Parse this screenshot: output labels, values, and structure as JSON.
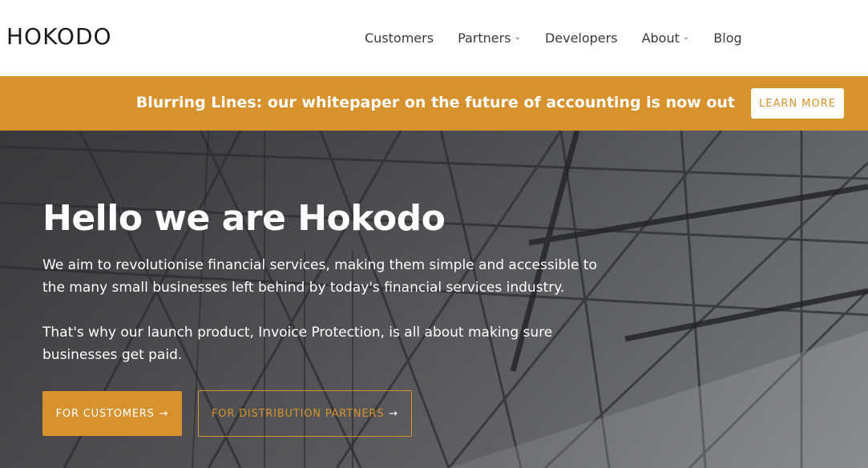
{
  "header": {
    "logo_text": "HOKODO",
    "nav": [
      {
        "label": "Customers",
        "dropdown": false
      },
      {
        "label": "Partners",
        "dropdown": true
      },
      {
        "label": "Developers",
        "dropdown": false
      },
      {
        "label": "About",
        "dropdown": true
      },
      {
        "label": "Blog",
        "dropdown": false
      }
    ]
  },
  "banner": {
    "text": "Blurring Lines: our whitepaper on the future of accounting is now out",
    "button_label": "LEARN MORE"
  },
  "hero": {
    "title": "Hello we are Hokodo",
    "paragraph_1": "We aim to revolutionise financial services, making them simple and accessible to the many small businesses left behind by today's financial services industry.",
    "paragraph_2": "That's why our launch product, Invoice Protection, is all about making sure businesses get paid.",
    "primary_button": "FOR CUSTOMERS",
    "secondary_button": "FOR DISTRIBUTION PARTNERS",
    "arrow": "→"
  },
  "icons": {
    "chevron": "chevron-down-icon",
    "arrow": "arrow-right-icon"
  },
  "colors": {
    "accent": "#d8922d",
    "hero_bg": "#5a5c5e",
    "text_dark": "#3a3a3a"
  }
}
